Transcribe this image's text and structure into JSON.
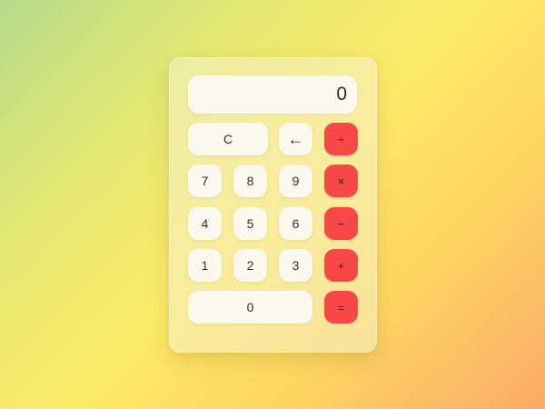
{
  "display": {
    "value": "0"
  },
  "keys": {
    "clear": "C",
    "backspace": "←",
    "divide": "÷",
    "seven": "7",
    "eight": "8",
    "nine": "9",
    "multiply": "×",
    "four": "4",
    "five": "5",
    "six": "6",
    "subtract": "−",
    "one": "1",
    "two": "2",
    "three": "3",
    "add": "+",
    "zero": "0",
    "equals": "="
  },
  "colors": {
    "operator_key": "#fa4848",
    "number_key": "#fbf9ee",
    "background_start": "#b5da8c",
    "background_mid": "#fde968",
    "background_end": "#fba966"
  }
}
